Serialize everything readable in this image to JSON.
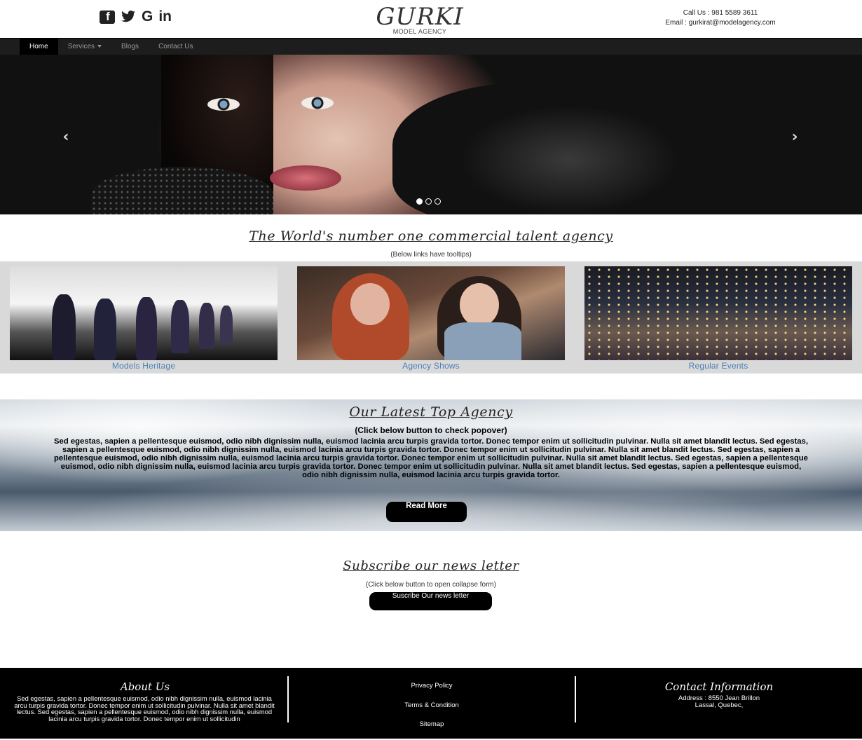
{
  "header": {
    "social": [
      "f",
      "t",
      "G",
      "in"
    ],
    "logo": {
      "name": "GURKI",
      "subtitle": "MODEL AGENCY"
    },
    "contact": {
      "phone": "Call Us : 981 5589 3611",
      "email": "Email : gurkirat@modelagency.com"
    }
  },
  "nav": {
    "items": [
      {
        "label": "Home",
        "active": true
      },
      {
        "label": "Services",
        "dropdown": true
      },
      {
        "label": "Blogs"
      },
      {
        "label": "Contact Us"
      }
    ]
  },
  "hero": {
    "prev_icon": "chevron-left-icon",
    "next_icon": "chevron-right-icon",
    "slides": 3,
    "active_slide": 1,
    "prev": "‹",
    "next": "›"
  },
  "world": {
    "title": "The World's number one commercial talent agency",
    "note": "(Below links have tooltips)"
  },
  "gallery": [
    {
      "label": "Models Heritage"
    },
    {
      "label": "Agency Shows"
    },
    {
      "label": "Regular Events"
    }
  ],
  "agency": {
    "title": "Our Latest Top Agency",
    "popover_note": "(Click below button to check popover)",
    "paragraph": "Sed egestas, sapien a pellentesque euismod, odio nibh dignissim nulla, euismod lacinia arcu turpis gravida tortor. Donec tempor enim ut sollicitudin pulvinar. Nulla sit amet blandit lectus. Sed egestas, sapien a pellentesque euismod, odio nibh dignissim nulla, euismod lacinia arcu turpis gravida tortor. Donec tempor enim ut sollicitudin pulvinar. Nulla sit amet blandit lectus. Sed egestas, sapien a pellentesque euismod, odio nibh dignissim nulla, euismod lacinia arcu turpis gravida tortor. Donec tempor enim ut sollicitudin pulvinar. Nulla sit amet blandit lectus. Sed egestas, sapien a pellentesque euismod, odio nibh dignissim nulla, euismod lacinia arcu turpis gravida tortor. Donec tempor enim ut sollicitudin pulvinar. Nulla sit amet blandit lectus. Sed egestas, sapien a pellentesque euismod, odio nibh dignissim nulla, euismod lacinia arcu turpis gravida tortor.",
    "button": "Read More"
  },
  "subscribe": {
    "title": "Subscribe our news letter",
    "note": "(Click below button to open collapse form)",
    "button": "Suscribe Our news letter"
  },
  "footer": {
    "about_title": "About Us",
    "about_text": "Sed egestas, sapien a pellentesque euismod, odio nibh dignissim nulla, euismod lacinia arcu turpis gravida tortor. Donec tempor enim ut sollicitudin pulvinar. Nulla sit amet blandit lectus. Sed egestas, sapien a pellentesque euismod, odio nibh dignissim nulla, euismod lacinia arcu turpis gravida tortor. Donec tempor enim ut sollicitudin",
    "links": [
      "Privacy Policy",
      "Terms & Condition",
      "Sitemap"
    ],
    "contact_title": "Contact Information",
    "address_line1": "Address : 8550 Jean Brillon",
    "address_line2": "Lassal, Quebec,"
  }
}
